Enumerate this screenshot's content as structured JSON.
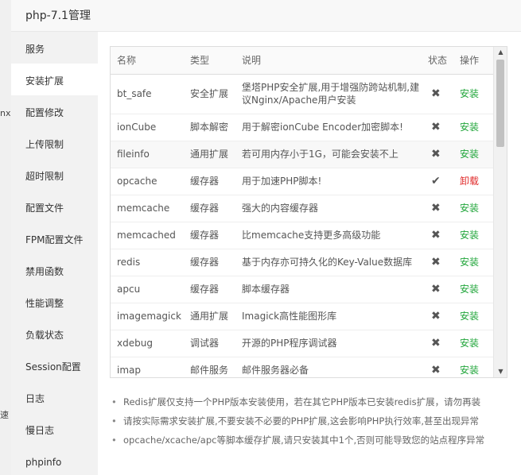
{
  "background_fragments": [
    "nx",
    "速"
  ],
  "dialog": {
    "title": "php-7.1管理"
  },
  "sidebar": {
    "items": [
      {
        "label": "服务",
        "active": false
      },
      {
        "label": "安装扩展",
        "active": true
      },
      {
        "label": "配置修改",
        "active": false
      },
      {
        "label": "上传限制",
        "active": false
      },
      {
        "label": "超时限制",
        "active": false
      },
      {
        "label": "配置文件",
        "active": false
      },
      {
        "label": "FPM配置文件",
        "active": false
      },
      {
        "label": "禁用函数",
        "active": false
      },
      {
        "label": "性能调整",
        "active": false
      },
      {
        "label": "负载状态",
        "active": false
      },
      {
        "label": "Session配置",
        "active": false
      },
      {
        "label": "日志",
        "active": false
      },
      {
        "label": "慢日志",
        "active": false
      },
      {
        "label": "phpinfo",
        "active": false
      }
    ]
  },
  "table": {
    "headers": {
      "name": "名称",
      "type": "类型",
      "desc": "说明",
      "status": "状态",
      "op": "操作"
    },
    "rows": [
      {
        "name": "bt_safe",
        "type": "安全扩展",
        "desc": "堡塔PHP安全扩展,用于增强防跨站机制,建议Nginx/Apache用户安装",
        "status": "✖",
        "op": "安装"
      },
      {
        "name": "ionCube",
        "type": "脚本解密",
        "desc": "用于解密ionCube Encoder加密脚本!",
        "status": "✖",
        "op": "安装"
      },
      {
        "name": "fileinfo",
        "type": "通用扩展",
        "desc": "若可用内存小于1G，可能会安装不上",
        "status": "✖",
        "op": "安装"
      },
      {
        "name": "opcache",
        "type": "缓存器",
        "desc": "用于加速PHP脚本!",
        "status": "✔",
        "op": "卸载"
      },
      {
        "name": "memcache",
        "type": "缓存器",
        "desc": "强大的内容缓存器",
        "status": "✖",
        "op": "安装"
      },
      {
        "name": "memcached",
        "type": "缓存器",
        "desc": "比memcache支持更多高级功能",
        "status": "✖",
        "op": "安装"
      },
      {
        "name": "redis",
        "type": "缓存器",
        "desc": "基于内存亦可持久化的Key-Value数据库",
        "status": "✖",
        "op": "安装"
      },
      {
        "name": "apcu",
        "type": "缓存器",
        "desc": "脚本缓存器",
        "status": "✖",
        "op": "安装"
      },
      {
        "name": "imagemagick",
        "type": "通用扩展",
        "desc": "Imagick高性能图形库",
        "status": "✖",
        "op": "安装"
      },
      {
        "name": "xdebug",
        "type": "调试器",
        "desc": "开源的PHP程序调试器",
        "status": "✖",
        "op": "安装"
      },
      {
        "name": "imap",
        "type": "邮件服务",
        "desc": "邮件服务器必备",
        "status": "✖",
        "op": "安装"
      }
    ]
  },
  "tips": [
    "Redis扩展仅支持一个PHP版本安装使用，若在其它PHP版本已安装redis扩展，请勿再装",
    "请按实际需求安装扩展,不要安装不必要的PHP扩展,这会影响PHP执行效率,甚至出现异常",
    "opcache/xcache/apc等脚本缓存扩展,请只安装其中1个,否则可能导致您的站点程序异常"
  ],
  "scrollbar": {
    "up_glyph": "▲",
    "down_glyph": "▼"
  },
  "colors": {
    "install": "#20a53a",
    "uninstall": "#e02a2a",
    "sidebar_bg": "#f2f2f2"
  }
}
